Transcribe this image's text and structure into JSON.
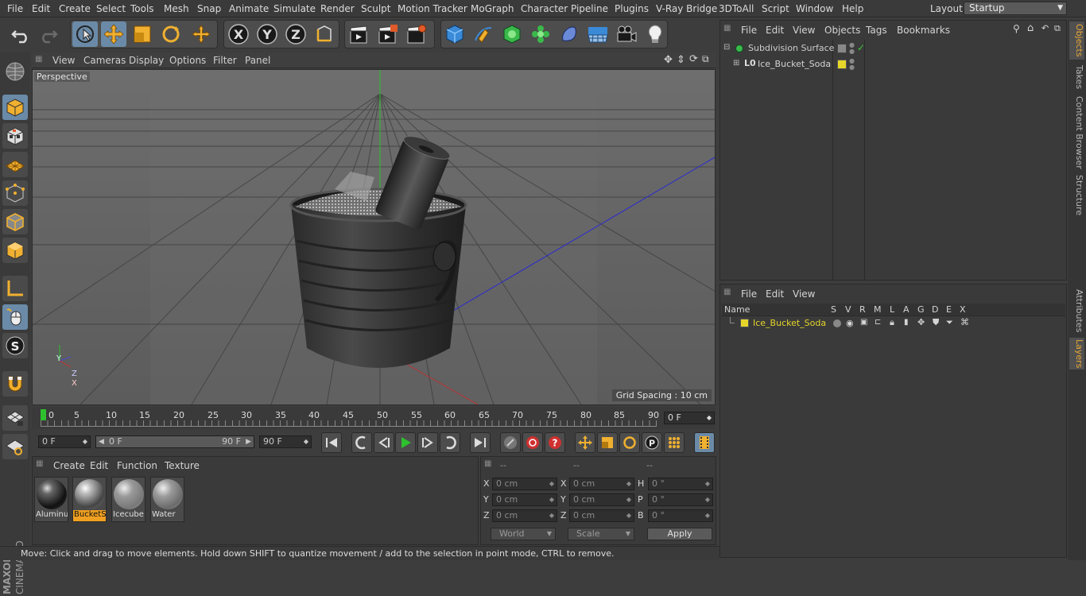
{
  "menubar": {
    "items": [
      "File",
      "Edit",
      "Create",
      "Select",
      "Tools",
      "Mesh",
      "Snap",
      "Animate",
      "Simulate",
      "Render",
      "Sculpt",
      "Motion Tracker",
      "MoGraph",
      "Character",
      "Pipeline",
      "Plugins",
      "V-Ray Bridge",
      "3DToAll",
      "Script",
      "Window",
      "Help"
    ],
    "layout_label": "Layout:",
    "layout_value": "Startup"
  },
  "viewport": {
    "menu": [
      "View",
      "Cameras",
      "Display",
      "Options",
      "Filter",
      "Panel"
    ],
    "label": "Perspective",
    "grid_spacing": "Grid Spacing : 10 cm",
    "axis_y": "Y",
    "axis_z": "Z",
    "axis_x": "X"
  },
  "timeline": {
    "ticks": [
      "0",
      "5",
      "10",
      "15",
      "20",
      "25",
      "30",
      "35",
      "40",
      "45",
      "50",
      "55",
      "60",
      "65",
      "70",
      "75",
      "80",
      "85",
      "90"
    ],
    "current_frame": "0 F"
  },
  "transport": {
    "start_frame": "0 F",
    "range_start": "0 F",
    "range_end": "90 F",
    "end_frame": "90 F"
  },
  "materials": {
    "menu": [
      "Create",
      "Edit",
      "Function",
      "Texture"
    ],
    "items": [
      {
        "label": "Aluminu",
        "selected": false
      },
      {
        "label": "BucketS",
        "selected": true
      },
      {
        "label": "Icecube:",
        "selected": false
      },
      {
        "label": "Water",
        "selected": false
      }
    ]
  },
  "coords": {
    "headers": [
      "--",
      "--",
      "--"
    ],
    "rows": [
      {
        "a": "X",
        "av": "0 cm",
        "b": "X",
        "bv": "0 cm",
        "c": "H",
        "cv": "0 °"
      },
      {
        "a": "Y",
        "av": "0 cm",
        "b": "Y",
        "bv": "0 cm",
        "c": "P",
        "cv": "0 °"
      },
      {
        "a": "Z",
        "av": "0 cm",
        "b": "Z",
        "bv": "0 cm",
        "c": "B",
        "cv": "0 °"
      }
    ],
    "mode": "World",
    "scale": "Scale",
    "apply": "Apply"
  },
  "status": "Move: Click and drag to move elements. Hold down SHIFT to quantize movement / add to the selection in point mode, CTRL to remove.",
  "objects": {
    "menu": [
      "File",
      "Edit",
      "View",
      "Objects",
      "Tags",
      "Bookmarks"
    ],
    "items": [
      {
        "name": "Subdivision Surface",
        "color": "#cccccc"
      },
      {
        "name": "Ice_Bucket_Soda",
        "color": "#d4d4d4"
      }
    ]
  },
  "layers": {
    "menu": [
      "File",
      "Edit",
      "View"
    ],
    "columns": [
      "Name",
      "S",
      "V",
      "R",
      "M",
      "L",
      "A",
      "G",
      "D",
      "E",
      "X"
    ],
    "rows": [
      {
        "name": "Ice_Bucket_Soda",
        "color": "#e6d52a"
      }
    ]
  },
  "side_tabs": [
    "Objects",
    "Takes",
    "Content Browser",
    "Structure",
    "Attributes",
    "Layers"
  ],
  "colors": {
    "accent": "#f0a020",
    "selection": "#6a8aa8",
    "layer": "#e6d52a"
  }
}
